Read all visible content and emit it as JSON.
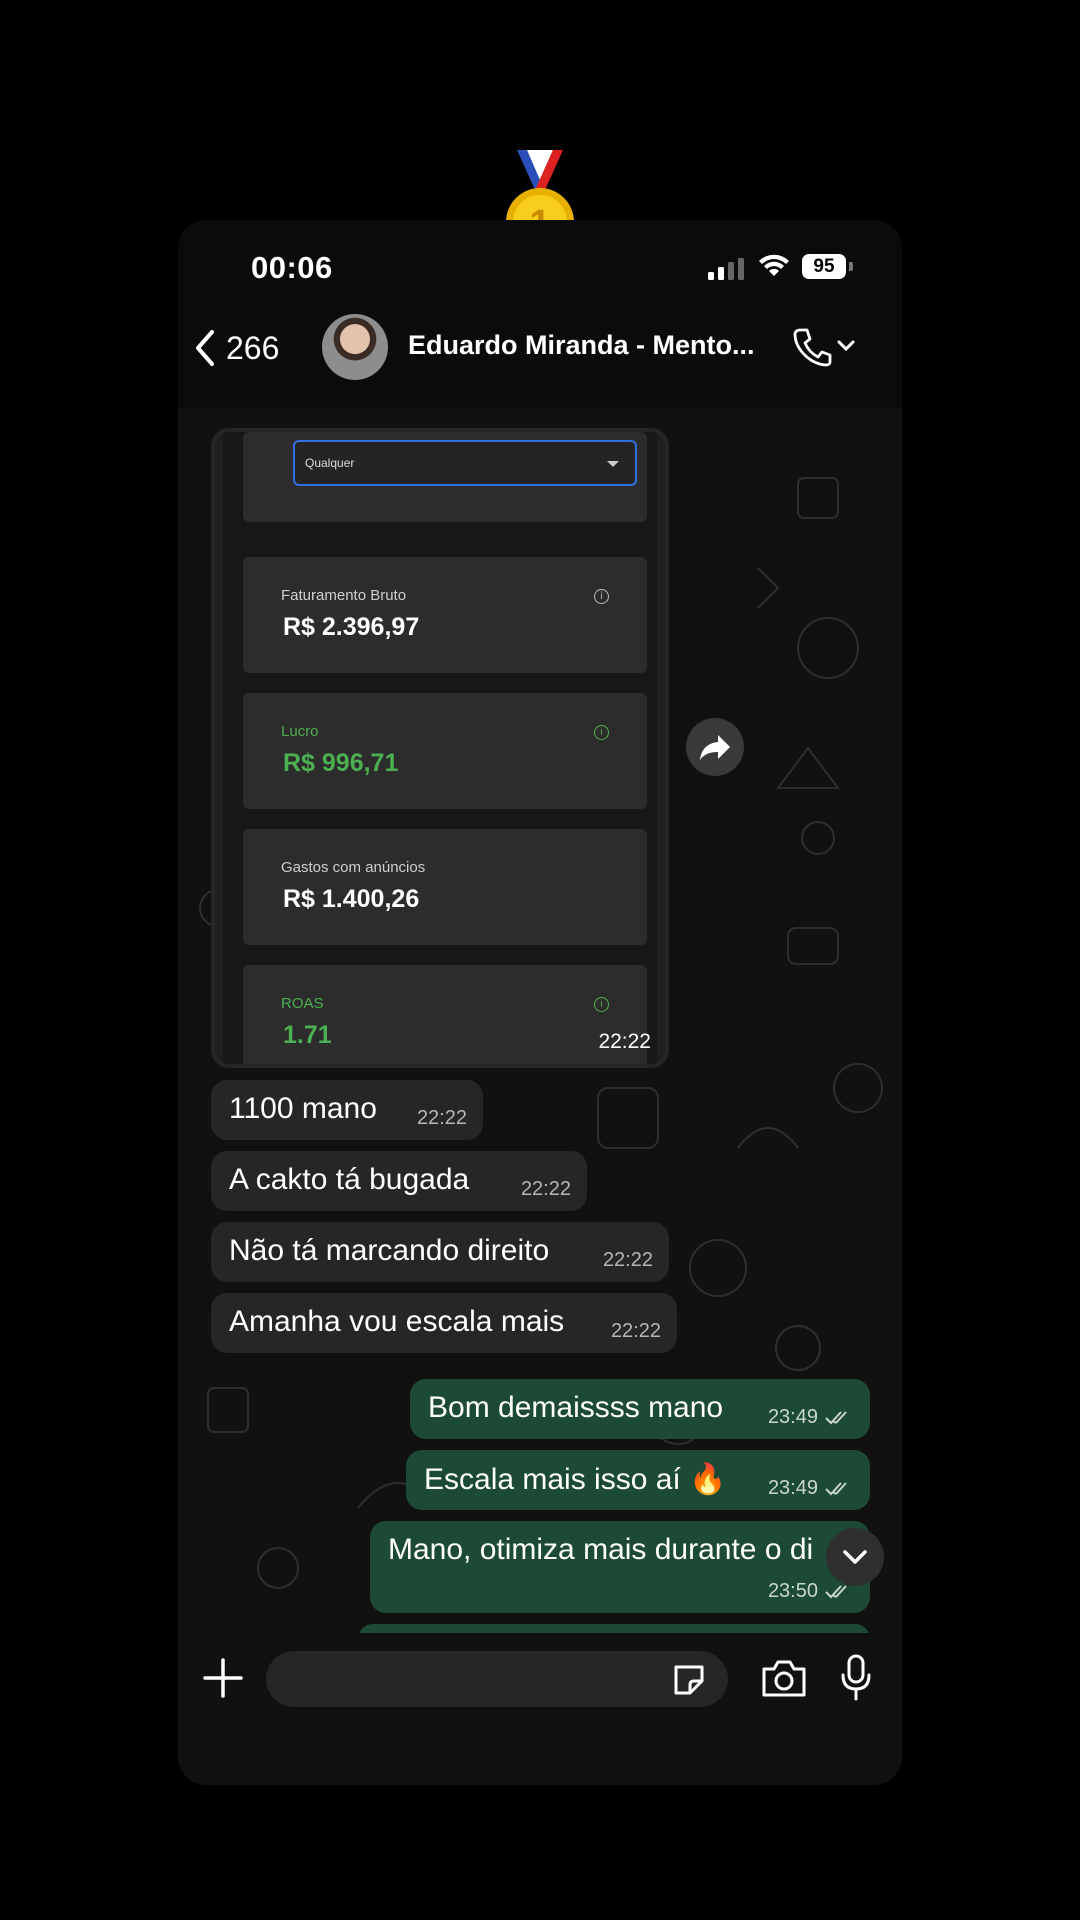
{
  "status_bar": {
    "time": "00:06",
    "battery": "95"
  },
  "header": {
    "back_count": "266",
    "chat_name": "Eduardo Miranda - Mento..."
  },
  "media_message": {
    "select_value": "Qualquer",
    "cards": [
      {
        "label": "Faturamento Bruto",
        "value": "R$ 2.396,97"
      },
      {
        "label": "Lucro",
        "value": "R$ 996,71"
      },
      {
        "label": "Gastos com anúncios",
        "value": "R$ 1.400,26"
      },
      {
        "label": "ROAS",
        "value": "1.71"
      }
    ],
    "time": "22:22"
  },
  "messages": [
    {
      "text": "1100 mano",
      "time": "22:22",
      "dir": "in"
    },
    {
      "text": "A cakto tá bugada",
      "time": "22:22",
      "dir": "in"
    },
    {
      "text": "Não tá marcando direito",
      "time": "22:22",
      "dir": "in"
    },
    {
      "text": "Amanha vou escala mais",
      "time": "22:22",
      "dir": "in"
    },
    {
      "text": "Bom demaissss mano",
      "time": "23:49",
      "dir": "out"
    },
    {
      "text": "Escala mais isso aí 🔥",
      "time": "23:49",
      "dir": "out"
    },
    {
      "text": "Mano, otimiza mais durante o di",
      "time": "23:50",
      "dir": "out"
    }
  ],
  "input": {
    "placeholder": ""
  },
  "colors": {
    "outgoing_bubble": "#1c4a35",
    "incoming_bubble": "#262626",
    "accent_green": "#4caf50"
  }
}
